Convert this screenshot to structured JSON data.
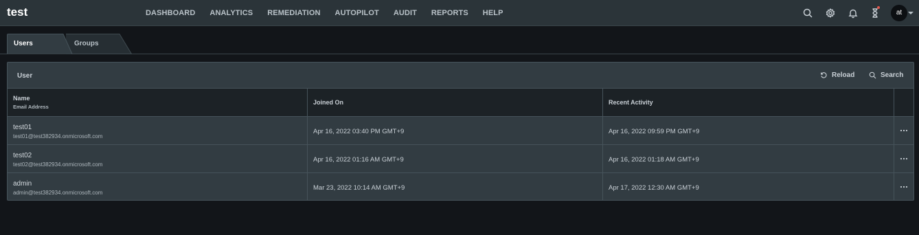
{
  "app": {
    "brand": "test"
  },
  "nav": [
    "DASHBOARD",
    "ANALYTICS",
    "REMEDIATION",
    "AUTOPILOT",
    "AUDIT",
    "REPORTS",
    "HELP"
  ],
  "header_icons": [
    "search-icon",
    "gear-icon",
    "bell-icon",
    "hourglass-icon"
  ],
  "user": {
    "initials": "at"
  },
  "tabs": [
    {
      "label": "Users",
      "active": true
    },
    {
      "label": "Groups",
      "active": false
    }
  ],
  "panel": {
    "title": "User",
    "reload_label": "Reload",
    "search_label": "Search"
  },
  "table": {
    "columns": {
      "name": "Name",
      "email": "Email Address",
      "joined": "Joined On",
      "activity": "Recent Activity"
    },
    "rows": [
      {
        "name": "test01",
        "email": "test01@test382934.onmicrosoft.com",
        "joined": "Apr 16, 2022 03:40 PM GMT+9",
        "activity": "Apr 16, 2022 09:59 PM GMT+9"
      },
      {
        "name": "test02",
        "email": "test02@test382934.onmicrosoft.com",
        "joined": "Apr 16, 2022 01:16 AM GMT+9",
        "activity": "Apr 16, 2022 01:18 AM GMT+9"
      },
      {
        "name": "admin",
        "email": "admin@test382934.onmicrosoft.com",
        "joined": "Mar 23, 2022 10:14 AM GMT+9",
        "activity": "Apr 17, 2022 12:30 AM GMT+9"
      }
    ]
  },
  "colors": {
    "topbar": "#2b3439",
    "background": "#121519",
    "panel": "#323c42",
    "notification_dot": "#e4574d"
  }
}
